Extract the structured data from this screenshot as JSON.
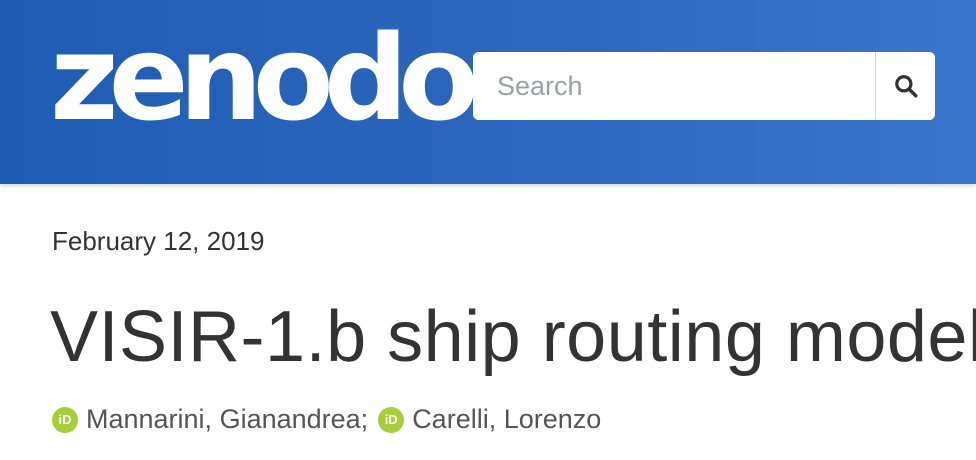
{
  "header": {
    "logo_text": "zenodo",
    "brand_color": "#2a63bb",
    "search": {
      "placeholder": "Search",
      "value": ""
    },
    "search_icon": "search-icon"
  },
  "record": {
    "date": "February 12, 2019",
    "title": "VISIR-1.b ship routing model",
    "authors": [
      {
        "name": "Mannarini, Gianandrea",
        "icon": "orcid-icon"
      },
      {
        "name": "Carelli, Lorenzo",
        "icon": "orcid-icon"
      }
    ],
    "author_separator": ";",
    "orcid_color": "#a6ce39",
    "orcid_label": "iD"
  }
}
